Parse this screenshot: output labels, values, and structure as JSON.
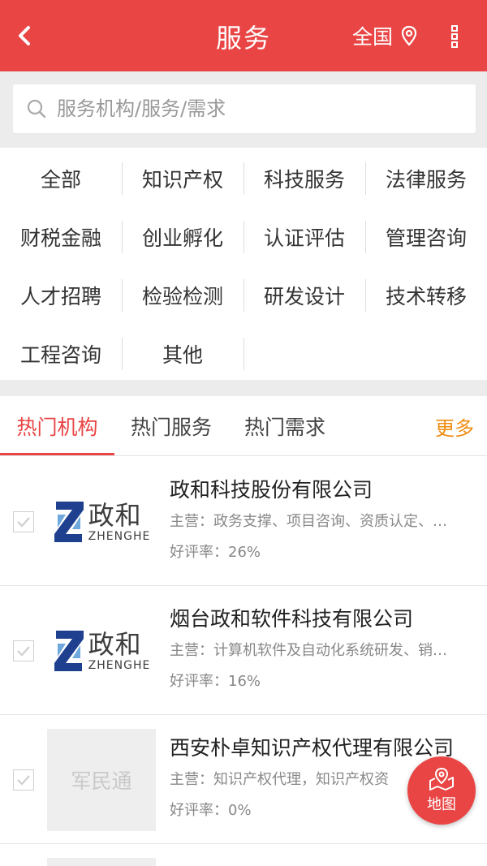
{
  "header": {
    "title": "服务",
    "region": "全国",
    "bg_color": "#e94545",
    "back_icon": "chevron-left-icon",
    "location_icon": "map-pin-icon",
    "more_icon": "vertical-dots-icon"
  },
  "search": {
    "placeholder": "服务机构/服务/需求",
    "value": ""
  },
  "categories": [
    "全部",
    "知识产权",
    "科技服务",
    "法律服务",
    "财税金融",
    "创业孵化",
    "认证评估",
    "管理咨询",
    "人才招聘",
    "检验检测",
    "研发设计",
    "技术转移",
    "工程咨询",
    "其他"
  ],
  "hot_tabs": {
    "tabs": [
      "热门机构",
      "热门服务",
      "热门需求"
    ],
    "active_index": 0,
    "more_label": "更多",
    "active_color": "#e94545",
    "more_color": "#f08c12"
  },
  "organizations": [
    {
      "name": "政和科技股份有限公司",
      "main": "主营：政务支撑、项目咨询、资质认定、…",
      "rating": "好评率：26%",
      "logo_cn": "政和",
      "logo_en": "ZHENGHE",
      "checked": true
    },
    {
      "name": "烟台政和软件科技有限公司",
      "main": "主营：计算机软件及自动化系统研发、销…",
      "rating": "好评率：16%",
      "logo_cn": "政和",
      "logo_en": "ZHENGHE",
      "checked": true
    },
    {
      "name": "西安朴卓知识产权代理有限公司",
      "main": "主营：知识产权代理，知识产权资",
      "rating": "好评率：0%",
      "logo_placeholder": "军民通",
      "checked": true
    }
  ],
  "map_fab": {
    "label": "地图",
    "icon": "map-icon"
  }
}
